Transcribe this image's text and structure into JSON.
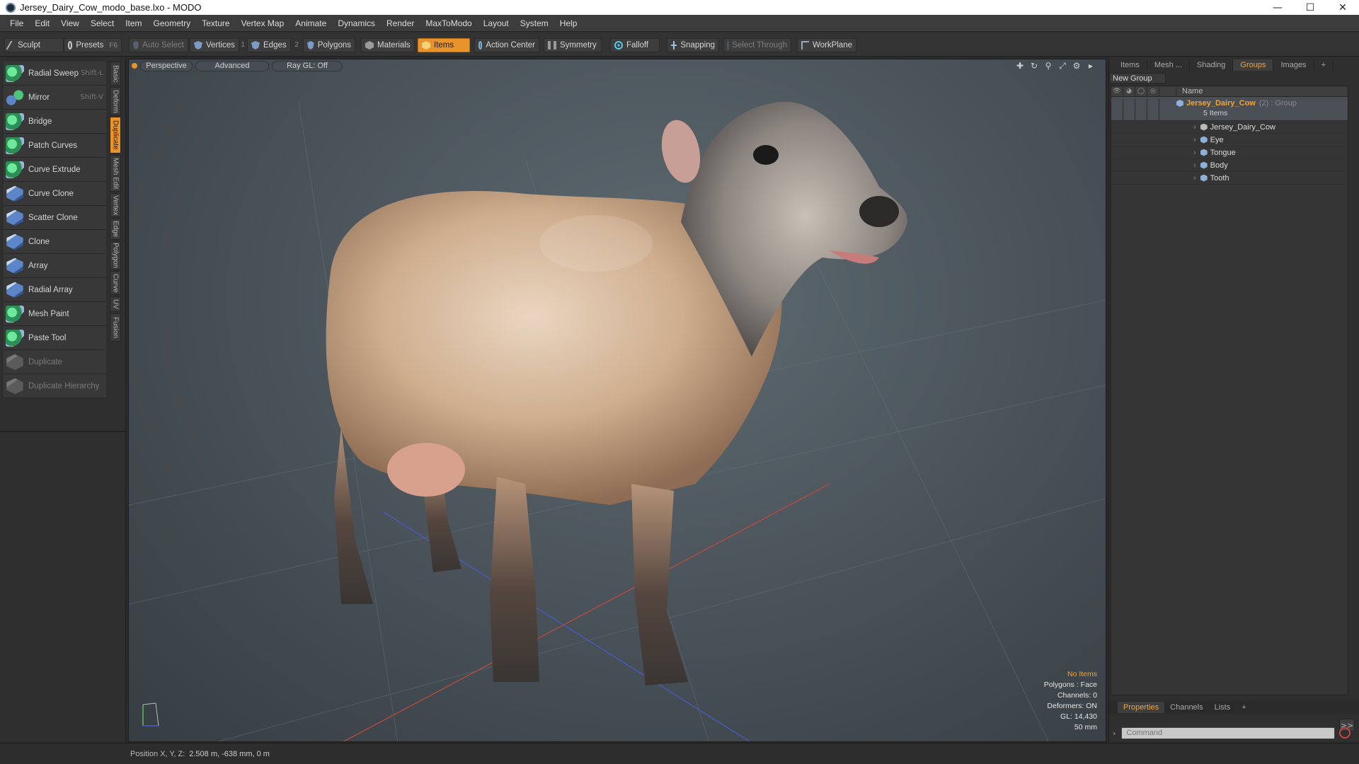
{
  "window": {
    "title": "Jersey_Dairy_Cow_modo_base.lxo - MODO"
  },
  "menu": [
    "File",
    "Edit",
    "View",
    "Select",
    "Item",
    "Geometry",
    "Texture",
    "Vertex Map",
    "Animate",
    "Dynamics",
    "Render",
    "MaxToModo",
    "Layout",
    "System",
    "Help"
  ],
  "toolbar": {
    "sculpt": "Sculpt",
    "presets": "Presets",
    "presets_shortcut": "F6",
    "auto_select": "Auto Select",
    "vertices": "Vertices",
    "vertices_num": "1",
    "edges": "Edges",
    "edges_num": "2",
    "polygons": "Polygons",
    "materials": "Materials",
    "items": "Items",
    "action_center": "Action Center",
    "symmetry": "Symmetry",
    "falloff": "Falloff",
    "snapping": "Snapping",
    "select_through": "Select Through",
    "workplane": "WorkPlane"
  },
  "tools": [
    {
      "label": "Radial Sweep",
      "shortcut": "Shift-L",
      "icon": "green"
    },
    {
      "label": "Mirror",
      "shortcut": "Shift-V",
      "icon": "mixed"
    },
    {
      "label": "Bridge",
      "shortcut": "",
      "icon": "green"
    },
    {
      "label": "Patch Curves",
      "shortcut": "",
      "icon": "green"
    },
    {
      "label": "Curve Extrude",
      "shortcut": "",
      "icon": "green"
    },
    {
      "label": "Curve Clone",
      "shortcut": "",
      "icon": "blue"
    },
    {
      "label": "Scatter Clone",
      "shortcut": "",
      "icon": "blue"
    },
    {
      "label": "Clone",
      "shortcut": "",
      "icon": "blue"
    },
    {
      "label": "Array",
      "shortcut": "",
      "icon": "blue"
    },
    {
      "label": "Radial Array",
      "shortcut": "",
      "icon": "blue"
    },
    {
      "label": "Mesh Paint",
      "shortcut": "",
      "icon": "green"
    },
    {
      "label": "Paste Tool",
      "shortcut": "",
      "icon": "green"
    },
    {
      "label": "Duplicate",
      "shortcut": "",
      "icon": "grey"
    },
    {
      "label": "Duplicate Hierarchy",
      "shortcut": "",
      "icon": "grey"
    }
  ],
  "vertical_tabs": [
    "Basic",
    "Deform",
    "Duplicate",
    "Mesh Edit",
    "Vertex",
    "Edge",
    "Polygon",
    "Curve",
    "UV",
    "Fusion"
  ],
  "active_vertical_tab": "Duplicate",
  "viewport": {
    "view": "Perspective",
    "mode": "Advanced",
    "raygl": "Ray GL: Off",
    "info": {
      "items": "No Items",
      "polygons": "Polygons : Face",
      "channels": "Channels: 0",
      "deformers": "Deformers: ON",
      "gl": "GL: 14,430",
      "lens": "50 mm"
    }
  },
  "right_tabs": [
    "Items",
    "Mesh ...",
    "Shading",
    "Groups",
    "Images"
  ],
  "active_right_tab": "Groups",
  "groups": {
    "new_group": "New Group",
    "name_header": "Name",
    "group_name": "Jersey_Dairy_Cow",
    "group_meta": "(2) : Group",
    "item_count": "5 Items",
    "children": [
      "Jersey_Dairy_Cow",
      "Eye",
      "Tongue",
      "Body",
      "Tooth"
    ]
  },
  "bottom_tabs": [
    "Properties",
    "Channels",
    "Lists"
  ],
  "active_bottom_tab": "Properties",
  "command": {
    "placeholder": "Command",
    "expand": ">>"
  },
  "status": {
    "label": "Position X, Y, Z:",
    "value": "2.508 m, -638 mm, 0 m"
  },
  "colors": {
    "accent": "#e8942a",
    "group_highlight": "#f0a53a",
    "viewport_bg": "#4c555c"
  }
}
